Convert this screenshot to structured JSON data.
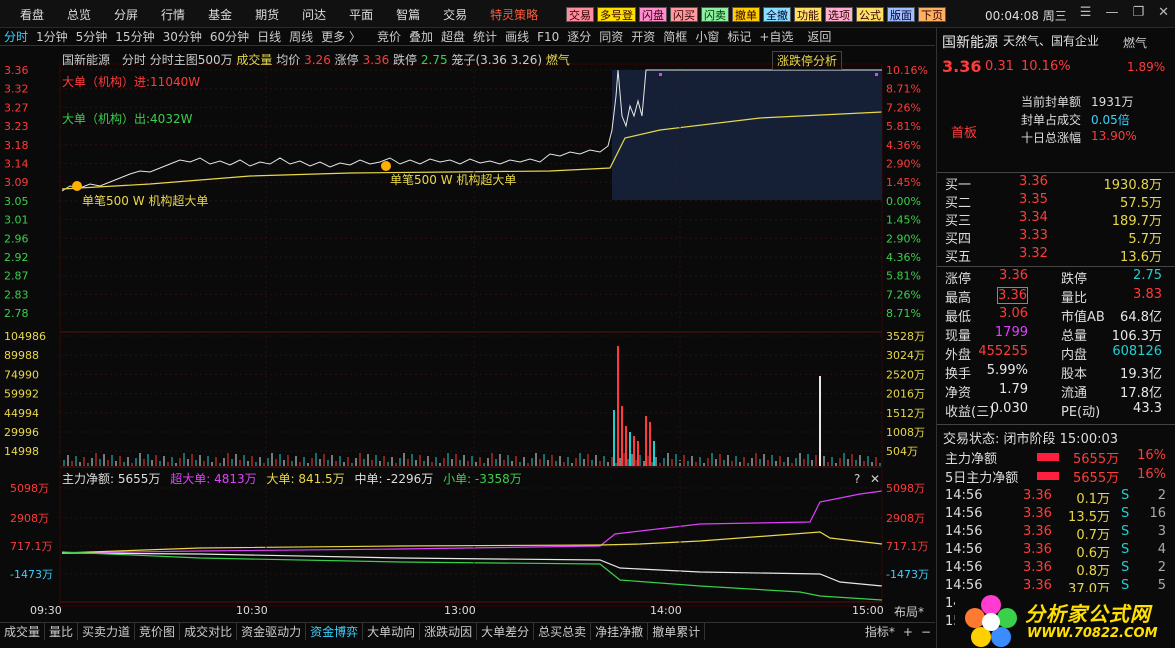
{
  "menu": {
    "items": [
      "看盘",
      "总览",
      "分屏",
      "行情",
      "基金",
      "期货",
      "问达",
      "平面",
      "智篇",
      "交易",
      "特灵策略"
    ]
  },
  "toolbar": {
    "buttons": [
      "交易",
      "多号登",
      "闪盘",
      "闪买",
      "闪卖",
      "撤单",
      "全撤",
      "功能",
      "选项",
      "公式",
      "版面",
      "下页"
    ]
  },
  "clock": {
    "time": "00:04:08",
    "weekday": "周三"
  },
  "tabs": [
    "分时",
    "1分钟",
    "5分钟",
    "15分钟",
    "30分钟",
    "60分钟",
    "日线",
    "周线",
    "更多 〉",
    "竞价",
    "叠加",
    "超盘",
    "统计",
    "画线",
    "F10",
    "逐分",
    "同资",
    "开资",
    "简框",
    "小窗",
    "标记",
    "+自选",
    "返回"
  ],
  "header": {
    "name": "国新能源",
    "items": [
      "分时",
      "分时主图500万",
      "成交量",
      "均价",
      "3.26",
      "涨停",
      "3.36",
      "跌停",
      "2.75",
      "笼子(3.36 3.26)",
      "燃气"
    ],
    "analysis": "涨跌停分析"
  },
  "legend": {
    "big_in": "大单（机构）进:11040W",
    "big_out": "大单（机构）出:4032W",
    "ann1": "单笔500 W 机构超大单",
    "ann2": "单笔500 W 机构超大单"
  },
  "price_axis": {
    "left": [
      "3.36",
      "3.32",
      "3.27",
      "3.23",
      "3.18",
      "3.14",
      "3.09",
      "3.05",
      "3.01",
      "2.96",
      "2.92",
      "2.87",
      "2.83",
      "2.78"
    ],
    "right": [
      "10.16%",
      "8.71%",
      "7.26%",
      "5.81%",
      "4.36%",
      "2.90%",
      "1.45%",
      "0.00%",
      "1.45%",
      "2.90%",
      "4.36%",
      "5.81%",
      "7.26%",
      "8.71%"
    ]
  },
  "vol_axis": {
    "left": [
      "104986",
      "89988",
      "74990",
      "59992",
      "44994",
      "29996",
      "14998"
    ],
    "right": [
      "3528万",
      "3024万",
      "2520万",
      "2016万",
      "1512万",
      "1008万",
      "504万"
    ]
  },
  "flow": {
    "title": "主力净额: 5655万",
    "super": "超大单: 4813万",
    "big": "大单: 841.5万",
    "mid": "中单: -2296万",
    "small": "小单: -3358万",
    "axis_left": [
      "5098万",
      "2908万",
      "717.1万",
      "-1473万"
    ],
    "axis_right": [
      "5098万",
      "2908万",
      "717.1万",
      "-1473万"
    ]
  },
  "time_axis": [
    "09:30",
    "10:30",
    "13:00",
    "14:00",
    "15:00"
  ],
  "layout_label": "布局*",
  "bottom_tabs": [
    "成交量",
    "量比",
    "买卖力道",
    "竞价图",
    "成交对比",
    "资金驱动力",
    "资金博弈",
    "大单动向",
    "涨跌动因",
    "大单差分",
    "总买总卖",
    "净挂净撤",
    "撤单累计"
  ],
  "bottom_right": "指标*",
  "quote": {
    "name": "国新能源",
    "tags": "天然气、国有企业",
    "sector": "燃气",
    "sector_pct": "1.89%",
    "price": "3.36",
    "chg": "0.31",
    "pct": "10.16%",
    "seal": "当前封单额",
    "seal_val": "1931万",
    "ratio": "封单占成交",
    "ratio_val": "0.05倍",
    "ten": "十日总涨幅",
    "ten_val": "13.90%",
    "board": "首板"
  },
  "book": [
    [
      "买一",
      "3.36",
      "1930.8万"
    ],
    [
      "买二",
      "3.35",
      "57.5万"
    ],
    [
      "买三",
      "3.34",
      "189.7万"
    ],
    [
      "买四",
      "3.33",
      "5.7万"
    ],
    [
      "买五",
      "3.32",
      "13.6万"
    ]
  ],
  "stats": [
    [
      "涨停",
      "3.36",
      "跌停",
      "2.75"
    ],
    [
      "最高",
      "3.36",
      "量比",
      "3.83"
    ],
    [
      "最低",
      "3.06",
      "市值AB",
      "64.8亿"
    ],
    [
      "现量",
      "1799",
      "总量",
      "106.3万"
    ],
    [
      "外盘",
      "455255",
      "内盘",
      "608126"
    ],
    [
      "换手",
      "5.99%",
      "股本",
      "19.3亿"
    ],
    [
      "净资",
      "1.79",
      "流通",
      "17.8亿"
    ],
    [
      "收益(三)",
      "0.030",
      "PE(动)",
      "43.3"
    ]
  ],
  "status": "交易状态: 闭市阶段 15:00:03",
  "flows": [
    [
      "主力净额",
      "5655万",
      "16%"
    ],
    [
      "5日主力净额",
      "5655万",
      "16%"
    ]
  ],
  "ticks": [
    [
      "14:56",
      "3.36",
      "0.1万",
      "S",
      "2"
    ],
    [
      "14:56",
      "3.36",
      "13.5万",
      "S",
      "16"
    ],
    [
      "14:56",
      "3.36",
      "0.7万",
      "S",
      "3"
    ],
    [
      "14:56",
      "3.36",
      "0.6万",
      "S",
      "4"
    ],
    [
      "14:56",
      "3.36",
      "0.8万",
      "S",
      "2"
    ],
    [
      "14:56",
      "3.36",
      "37.0万",
      "S",
      "5"
    ],
    [
      "14:5",
      "",
      " ",
      "",
      ""
    ],
    [
      "15:0",
      "",
      "",
      "",
      ""
    ]
  ],
  "brand": {
    "title": "分析家公式网",
    "url": "WWW.70822.COM"
  }
}
